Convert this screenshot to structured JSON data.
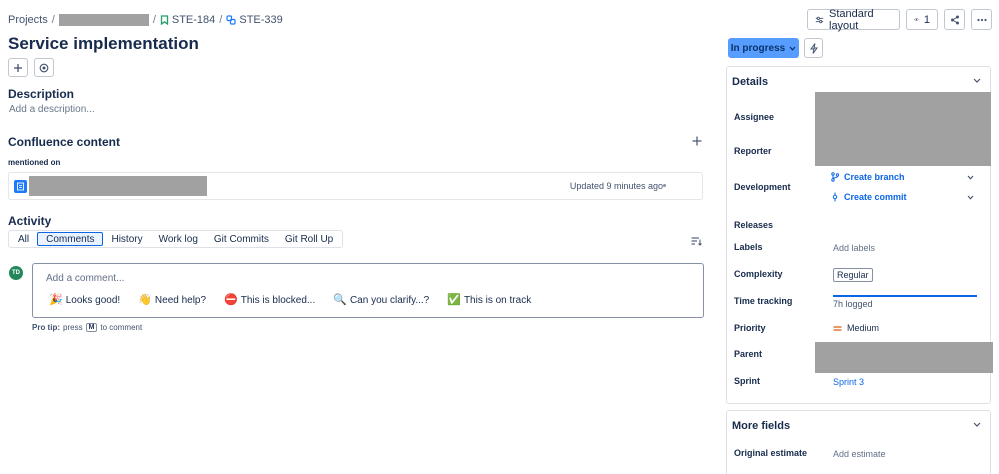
{
  "breadcrumb": {
    "root": "Projects",
    "parent_key": "STE-184",
    "current_key": "STE-339"
  },
  "top_actions": {
    "layout_label": "Standard layout",
    "watchers_count": "1"
  },
  "issue": {
    "title": "Service implementation"
  },
  "description": {
    "heading": "Description",
    "placeholder": "Add a description..."
  },
  "confluence": {
    "heading": "Confluence content",
    "subheading": "mentioned on",
    "updated": "Updated 9 minutes ago"
  },
  "activity": {
    "heading": "Activity",
    "tabs": [
      "All",
      "Comments",
      "History",
      "Work log",
      "Git Commits",
      "Git Roll Up"
    ],
    "active_tab": "Comments"
  },
  "comment": {
    "avatar_initials": "TD",
    "placeholder": "Add a comment...",
    "reactions": [
      {
        "emoji": "🎉",
        "label": "Looks good!"
      },
      {
        "emoji": "👋",
        "label": "Need help?"
      },
      {
        "emoji": "⛔",
        "label": "This is blocked..."
      },
      {
        "emoji": "🔍",
        "label": "Can you clarify...?"
      },
      {
        "emoji": "✅",
        "label": "This is on track"
      }
    ],
    "pro_tip_label": "Pro tip:",
    "pro_tip_pre": "press",
    "pro_tip_key": "M",
    "pro_tip_post": "to comment"
  },
  "status": {
    "label": "In progress",
    "color": "#579dff"
  },
  "details": {
    "heading": "Details",
    "fields": {
      "assignee": "Assignee",
      "reporter": "Reporter",
      "development": "Development",
      "releases": "Releases",
      "labels": "Labels",
      "complexity": "Complexity",
      "time_tracking": "Time tracking",
      "priority": "Priority",
      "parent": "Parent",
      "sprint": "Sprint"
    },
    "values": {
      "create_branch": "Create branch",
      "create_commit": "Create commit",
      "labels_placeholder": "Add labels",
      "complexity": "Regular",
      "time_logged": "7h logged",
      "time_progress_percent": 100,
      "priority": "Medium",
      "sprint": "Sprint 3"
    }
  },
  "more_fields": {
    "heading": "More fields",
    "original_estimate_label": "Original estimate",
    "original_estimate_placeholder": "Add estimate"
  }
}
